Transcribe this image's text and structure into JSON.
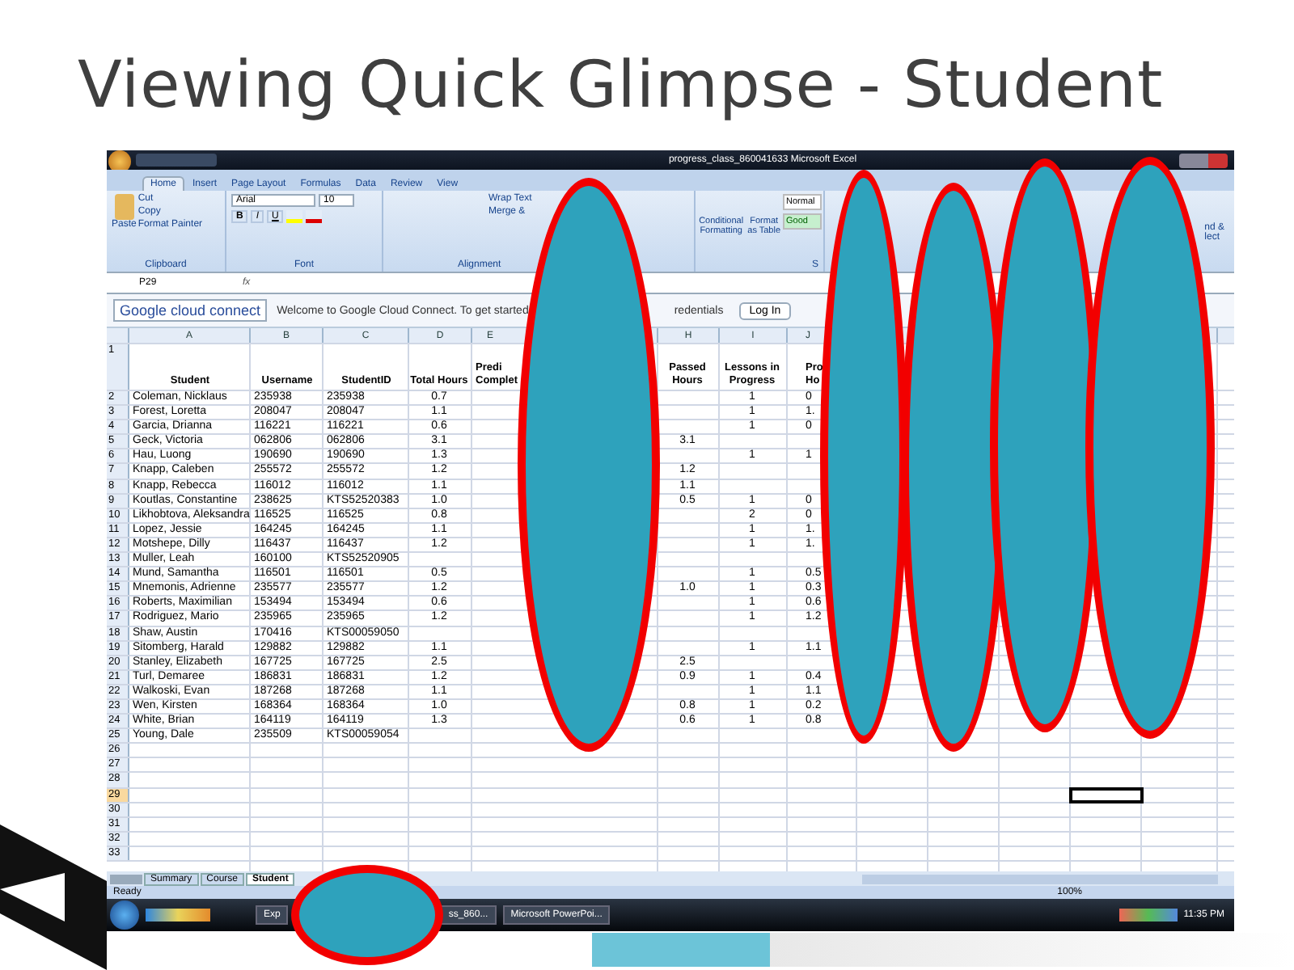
{
  "slide_title": "Viewing Quick Glimpse - Student",
  "excel": {
    "title": "progress_class_860041633   Microsoft Excel",
    "ribbon_tabs": [
      {
        "label": "Home",
        "selected": true
      },
      {
        "label": "Insert",
        "selected": false
      },
      {
        "label": "Page Layout",
        "selected": false
      },
      {
        "label": "Formulas",
        "selected": false
      },
      {
        "label": "Data",
        "selected": false
      },
      {
        "label": "Review",
        "selected": false
      },
      {
        "label": "View",
        "selected": false
      }
    ],
    "clipboard": {
      "paste": "Paste",
      "cut": "Cut",
      "copy": "Copy",
      "format_painter": "Format Painter",
      "label": "Clipboard"
    },
    "font": {
      "name": "Arial",
      "size": "10",
      "bold": "B",
      "italic": "I",
      "underline": "U",
      "label": "Font"
    },
    "alignment": {
      "wrap": "Wrap Text",
      "merge": "Merge &",
      "label": "Alignment"
    },
    "styles": {
      "conditional": "Conditional Formatting",
      "format_table": "Format as Table",
      "normal": "Normal",
      "good": "Good",
      "label": "S"
    },
    "editing": {
      "find": "nd &",
      "select": "lect"
    },
    "name_box": "P29",
    "fx": "fx",
    "google_bar": {
      "brand": "Google cloud connect",
      "message": "Welcome to Google Cloud Connect. To get started",
      "partial": "redentials",
      "login": "Log In"
    },
    "columns": [
      "A",
      "B",
      "C",
      "D",
      "E",
      "H",
      "I",
      "J"
    ],
    "header_row": "1",
    "headers": [
      "Student",
      "Username",
      "StudentID",
      "Total Hours",
      "Predi\nComplet",
      "Passed\nHours",
      "Lessons in\nProgress",
      "Pro\nHo"
    ],
    "rows": [
      {
        "row": "2",
        "cells": [
          "Coleman, Nicklaus",
          "235938",
          "235938",
          "0.7",
          "",
          "",
          "1",
          "0"
        ]
      },
      {
        "row": "3",
        "cells": [
          "Forest, Loretta",
          "208047",
          "208047",
          "1.1",
          "",
          "",
          "1",
          "1."
        ]
      },
      {
        "row": "4",
        "cells": [
          "Garcia, Drianna",
          "116221",
          "116221",
          "0.6",
          "",
          "",
          "1",
          "0"
        ]
      },
      {
        "row": "5",
        "cells": [
          "Geck, Victoria",
          "062806",
          "062806",
          "3.1",
          "",
          "3.1",
          "",
          ""
        ]
      },
      {
        "row": "6",
        "cells": [
          "Hau, Luong",
          "190690",
          "190690",
          "1.3",
          "",
          "",
          "1",
          "1"
        ]
      },
      {
        "row": "7",
        "cells": [
          "Knapp, Caleben",
          "255572",
          "255572",
          "1.2",
          "",
          "1.2",
          "",
          ""
        ]
      },
      {
        "row": "8",
        "cells": [
          "Knapp, Rebecca",
          "116012",
          "116012",
          "1.1",
          "",
          "1.1",
          "",
          ""
        ]
      },
      {
        "row": "9",
        "cells": [
          "Koutlas, Constantine",
          "238625",
          "KTS52520383",
          "1.0",
          "",
          "0.5",
          "1",
          "0"
        ]
      },
      {
        "row": "10",
        "cells": [
          "Likhobtova, Aleksandra",
          "116525",
          "116525",
          "0.8",
          "",
          "",
          "2",
          "0"
        ]
      },
      {
        "row": "11",
        "cells": [
          "Lopez, Jessie",
          "164245",
          "164245",
          "1.1",
          "",
          "",
          "1",
          "1."
        ]
      },
      {
        "row": "12",
        "cells": [
          "Motshepe, Dilly",
          "116437",
          "116437",
          "1.2",
          "",
          "",
          "1",
          "1."
        ]
      },
      {
        "row": "13",
        "cells": [
          "Muller, Leah",
          "160100",
          "KTS52520905",
          "",
          "",
          "",
          "",
          ""
        ]
      },
      {
        "row": "14",
        "cells": [
          "Mund, Samantha",
          "116501",
          "116501",
          "0.5",
          "",
          "",
          "1",
          "0.5"
        ]
      },
      {
        "row": "15",
        "cells": [
          "Mnemonis, Adrienne",
          "235577",
          "235577",
          "1.2",
          "",
          "1.0",
          "1",
          "0.3"
        ]
      },
      {
        "row": "16",
        "cells": [
          "Roberts, Maximilian",
          "153494",
          "153494",
          "0.6",
          "",
          "",
          "1",
          "0.6"
        ]
      },
      {
        "row": "17",
        "cells": [
          "Rodriguez, Mario",
          "235965",
          "235965",
          "1.2",
          "",
          "",
          "1",
          "1.2"
        ]
      },
      {
        "row": "18",
        "cells": [
          "Shaw, Austin",
          "170416",
          "KTS00059050",
          "",
          "",
          "",
          "",
          ""
        ]
      },
      {
        "row": "19",
        "cells": [
          "Sitomberg, Harald",
          "129882",
          "129882",
          "1.1",
          "",
          "",
          "1",
          "1.1"
        ]
      },
      {
        "row": "20",
        "cells": [
          "Stanley, Elizabeth",
          "167725",
          "167725",
          "2.5",
          "",
          "2.5",
          "",
          ""
        ]
      },
      {
        "row": "21",
        "cells": [
          "Turl, Demaree",
          "186831",
          "186831",
          "1.2",
          "",
          "0.9",
          "1",
          "0.4"
        ]
      },
      {
        "row": "22",
        "cells": [
          "Walkoski, Evan",
          "187268",
          "187268",
          "1.1",
          "",
          "",
          "1",
          "1.1"
        ]
      },
      {
        "row": "23",
        "cells": [
          "Wen, Kirsten",
          "168364",
          "168364",
          "1.0",
          "",
          "0.8",
          "1",
          "0.2"
        ]
      },
      {
        "row": "24",
        "cells": [
          "White, Brian",
          "164119",
          "164119",
          "1.3",
          "",
          "0.6",
          "1",
          "0.8"
        ]
      },
      {
        "row": "25",
        "cells": [
          "Young, Dale",
          "235509",
          "KTS00059054",
          "",
          "",
          "",
          "",
          ""
        ]
      }
    ],
    "empty_rows": [
      {
        "row": "26",
        "selected": false
      },
      {
        "row": "27",
        "selected": false
      },
      {
        "row": "28",
        "selected": false
      },
      {
        "row": "29",
        "selected": true
      },
      {
        "row": "30",
        "selected": false
      },
      {
        "row": "31",
        "selected": false
      },
      {
        "row": "32",
        "selected": false
      },
      {
        "row": "33",
        "selected": false
      }
    ],
    "sheet_tabs": [
      {
        "label": "Summary",
        "selected": false
      },
      {
        "label": "Course",
        "selected": false
      },
      {
        "label": "Student",
        "selected": true
      }
    ],
    "status": "Ready",
    "zoom": "100%"
  },
  "taskbar": {
    "items": [
      "Exp",
      "ss_860...",
      "Microsoft PowerPoi..."
    ],
    "time": "11:35 PM"
  }
}
